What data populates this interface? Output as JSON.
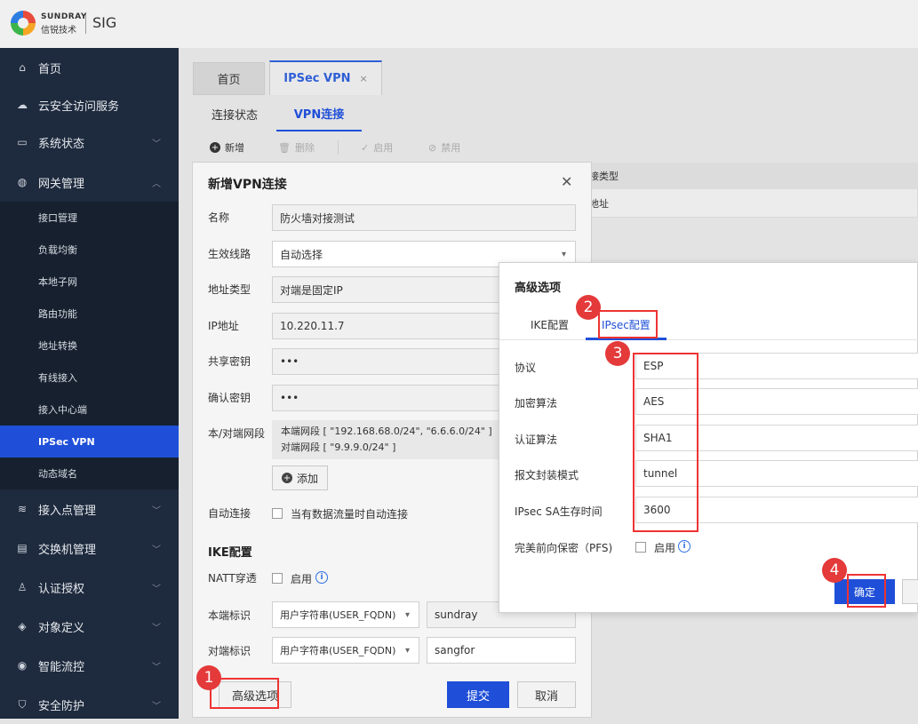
{
  "header": {
    "brand_en": "SUNDRAY",
    "brand_cn": "信锐技术",
    "product": "SIG"
  },
  "sidebar": {
    "items": [
      {
        "label": "首页",
        "icon": "home-icon"
      },
      {
        "label": "云安全访问服务",
        "icon": "cloud-icon"
      },
      {
        "label": "系统状态",
        "icon": "monitor-icon"
      },
      {
        "label": "网关管理",
        "icon": "globe-icon"
      },
      {
        "label": "接入点管理",
        "icon": "wifi-icon"
      },
      {
        "label": "交换机管理",
        "icon": "switch-icon"
      },
      {
        "label": "认证授权",
        "icon": "user-icon"
      },
      {
        "label": "对象定义",
        "icon": "cube-icon"
      },
      {
        "label": "智能流控",
        "icon": "drop-icon"
      },
      {
        "label": "安全防护",
        "icon": "shield-icon"
      }
    ],
    "subitems": [
      "接口管理",
      "负载均衡",
      "本地子网",
      "路由功能",
      "地址转换",
      "有线接入",
      "接入中心端",
      "IPSec VPN",
      "动态域名"
    ]
  },
  "tabs": {
    "home": "首页",
    "ipsec": "IPSec VPN",
    "close": "×"
  },
  "subtabs": {
    "status": "连接状态",
    "vpn": "VPN连接"
  },
  "toolbar": {
    "add": "新增",
    "delete": "删除",
    "enable": "启用",
    "disable": "禁用"
  },
  "bg_table": {
    "header": "接类型",
    "cell": "地址"
  },
  "dialog": {
    "title": "新增VPN连接",
    "name_label": "名称",
    "name_value": "防火墙对接测试",
    "line_label": "生效线路",
    "line_value": "自动选择",
    "addr_type_label": "地址类型",
    "addr_type_value": "对端是固定IP",
    "ip_label": "IP地址",
    "ip_value": "10.220.11.7",
    "psk_label": "共享密钥",
    "psk_value": "•••",
    "confirm_label": "确认密钥",
    "confirm_value": "•••",
    "seg_label": "本/对端网段",
    "seg_local": "本端网段 [ \"192.168.68.0/24\", \"6.6.6.0/24\" ]",
    "seg_remote": "对端网段 [ \"9.9.9.0/24\" ]",
    "add_btn": "添加",
    "auto_label": "自动连接",
    "auto_text": "当有数据流量时自动连接",
    "ike_section": "IKE配置",
    "natt_label": "NATT穿透",
    "natt_text": "启用",
    "local_id_label": "本端标识",
    "local_id_type": "用户字符串(USER_FQDN)",
    "local_id_value": "sundray",
    "peer_id_label": "对端标识",
    "peer_id_type": "用户字符串(USER_FQDN)",
    "peer_id_value": "sangfor",
    "advanced_btn": "高级选项",
    "submit_btn": "提交",
    "cancel_btn": "取消"
  },
  "advanced": {
    "title": "高级选项",
    "tab_ike": "IKE配置",
    "tab_ipsec": "IPsec配置",
    "protocol_label": "协议",
    "protocol_value": "ESP",
    "enc_label": "加密算法",
    "enc_value": "AES",
    "auth_label": "认证算法",
    "auth_value": "SHA1",
    "mode_label": "报文封装模式",
    "mode_value": "tunnel",
    "life_label": "IPsec SA生存时间",
    "life_value": "3600",
    "pfs_label": "完美前向保密（PFS)",
    "pfs_text": "启用",
    "ok_btn": "确定"
  },
  "markers": [
    "1",
    "2",
    "3",
    "4"
  ],
  "colors": {
    "accent": "#1f4fd8",
    "sidebar": "#1e2a3d",
    "marker": "#e43a3a"
  }
}
